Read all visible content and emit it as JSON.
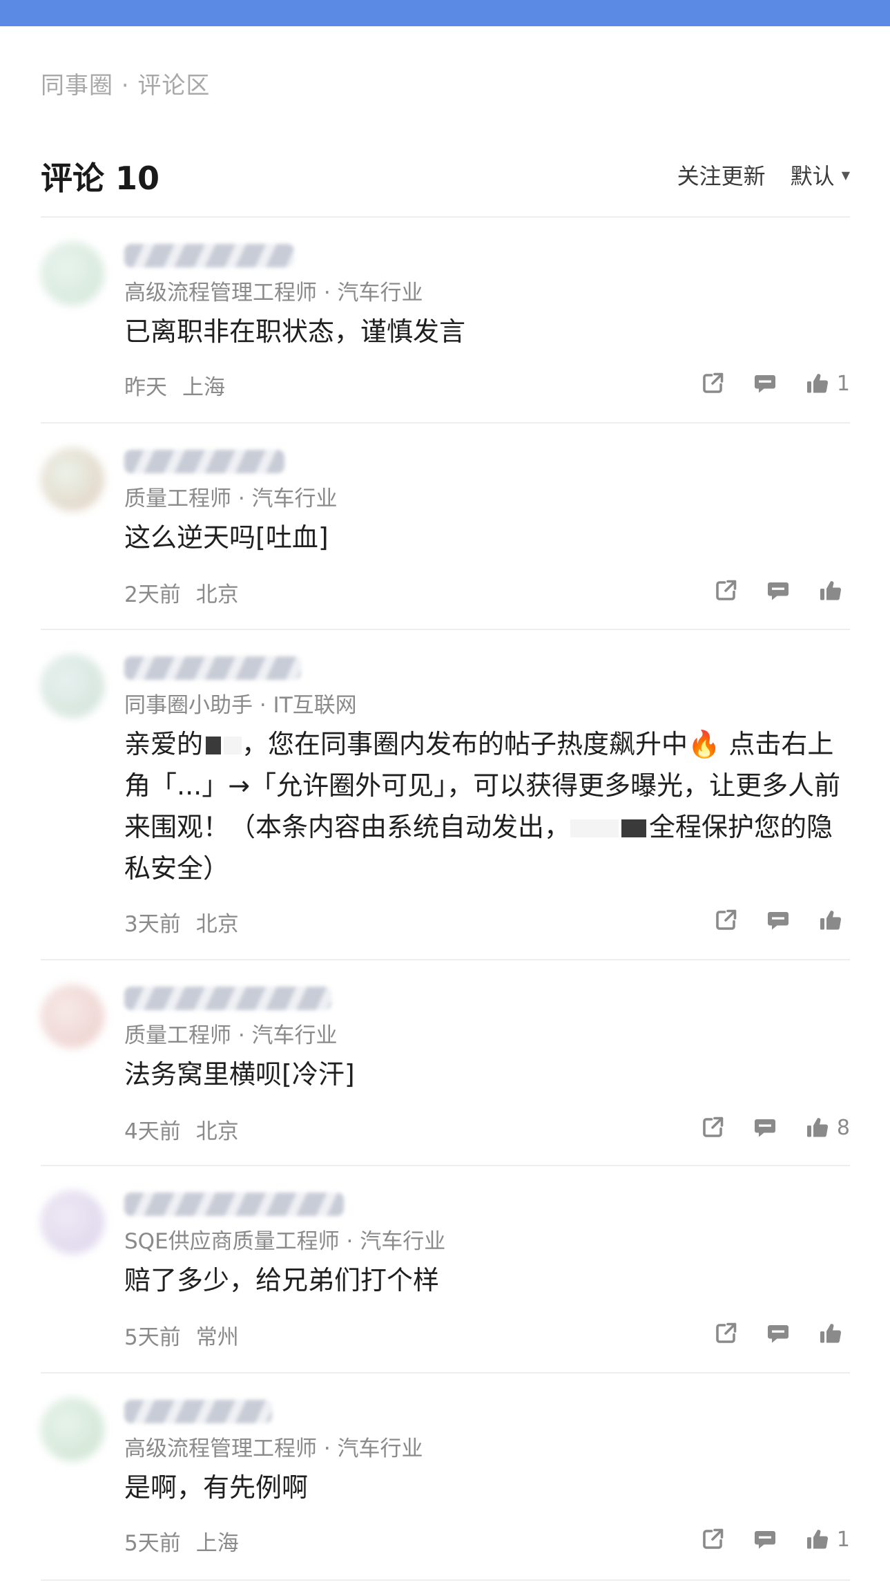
{
  "colors": {
    "topbar": "#5a8ae4",
    "accent_text": "#1a1a1a",
    "muted": "#8a8a8a"
  },
  "breadcrumb": "同事圈 · 评论区",
  "header": {
    "title": "评论 10",
    "follow_label": "关注更新",
    "sort_label": "默认",
    "sort_icon": "caret-down-icon"
  },
  "comments": [
    {
      "meta": "高级流程管理工程师 · 汽车行业",
      "content": "已离职非在职状态，谨慎发言",
      "time": "昨天",
      "location": "上海",
      "likes": "1"
    },
    {
      "meta": "质量工程师 · 汽车行业",
      "content": "这么逆天吗[吐血]",
      "time": "2天前",
      "location": "北京",
      "likes": ""
    },
    {
      "meta": "同事圈小助手 · IT互联网",
      "content_parts": [
        "亲爱的",
        "，您在同事圈内发布的帖子热度飙升中🔥 点击右上角「...」→「允许圈外可见」，可以获得更多曝光，让更多人前来围观！（本条内容由系统自动发出，",
        "全程保护您的隐私安全）"
      ],
      "time": "3天前",
      "location": "北京",
      "likes": ""
    },
    {
      "meta": "质量工程师 · 汽车行业",
      "content": "法务窝里横呗[冷汗]",
      "time": "4天前",
      "location": "北京",
      "likes": "8"
    },
    {
      "meta": "SQE供应商质量工程师 · 汽车行业",
      "content": "赔了多少，给兄弟们打个样",
      "time": "5天前",
      "location": "常州",
      "likes": ""
    },
    {
      "meta": "高级流程管理工程师 · 汽车行业",
      "content": "是啊，有先例啊",
      "time": "5天前",
      "location": "上海",
      "likes": "1"
    }
  ],
  "icons": {
    "share": "share-icon",
    "reply": "comment-icon",
    "like": "thumbs-up-icon"
  }
}
